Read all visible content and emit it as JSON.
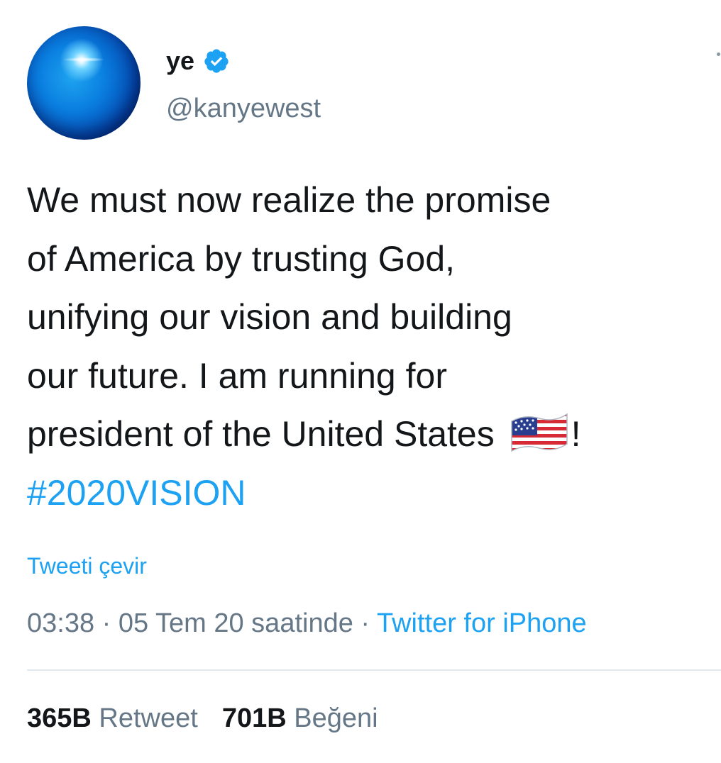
{
  "user": {
    "display_name": "ye",
    "handle": "@kanyewest",
    "verified": true
  },
  "tweet": {
    "lines": [
      "We must now realize the promise",
      "of America by trusting God,",
      "unifying our vision and building",
      "our future. I am running for",
      "president of the United States "
    ],
    "last_line_suffix": "!",
    "hashtag": "#2020VISION",
    "translate_label": "Tweeti çevir"
  },
  "meta": {
    "time": "03:38",
    "separator": " · ",
    "date": "05 Tem 20 saatinde",
    "source": "Twitter for iPhone"
  },
  "stats": {
    "retweets_count": "365B",
    "retweets_label": "Retweet",
    "likes_count": "701B",
    "likes_label": "Beğeni"
  },
  "colors": {
    "accent": "#1da1f2",
    "text": "#14171a",
    "muted": "#657786",
    "divider": "#e1e8ed"
  },
  "icons": {
    "verified": "verified-badge-icon",
    "flag": "us-flag-emoji",
    "more": "more-options-icon"
  }
}
